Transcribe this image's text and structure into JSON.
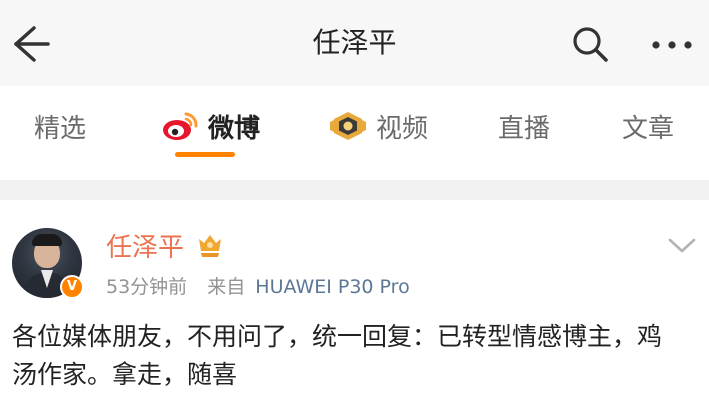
{
  "header": {
    "title": "任泽平",
    "back_icon": "back-arrow-icon",
    "search_icon": "search-icon",
    "more_icon": "more-icon"
  },
  "tabs": [
    {
      "label": "精选",
      "icon": null,
      "active": false
    },
    {
      "label": "微博",
      "icon": "weibo-logo-icon",
      "active": true
    },
    {
      "label": "视频",
      "icon": "video-badge-icon",
      "active": false
    },
    {
      "label": "直播",
      "icon": null,
      "active": false
    },
    {
      "label": "文章",
      "icon": null,
      "active": false
    }
  ],
  "post": {
    "author": "任泽平",
    "verified_badge": "V",
    "time": "53分钟前",
    "source_prefix": "来自",
    "device": "HUAWEI P30 Pro",
    "text": "各位媒体朋友，不用问了，统一回复：已转型情感博主，鸡汤作家。拿走，随喜"
  },
  "colors": {
    "accent": "#ff8200",
    "username": "#eb7350",
    "device_link": "#5d7895",
    "meta_text": "#939393"
  }
}
